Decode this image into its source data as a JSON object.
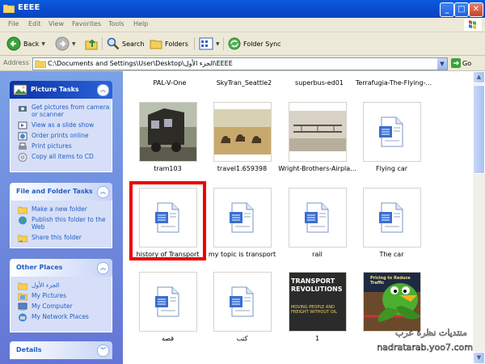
{
  "window": {
    "title": "EEEE"
  },
  "menu": {
    "items": [
      "File",
      "Edit",
      "View",
      "Favorites",
      "Tools",
      "Help"
    ]
  },
  "toolbar": {
    "back": "Back",
    "search": "Search",
    "folders": "Folders",
    "folder_sync": "Folder Sync"
  },
  "address": {
    "label": "Address",
    "path": "C:\\Documents and Settings\\User\\Desktop\\الجزء الأول\\EEEE",
    "go": "Go"
  },
  "sidebar": {
    "picture_tasks": {
      "title": "Picture Tasks",
      "items": [
        "Get pictures from camera or scanner",
        "View as a slide show",
        "Order prints online",
        "Print pictures",
        "Copy all items to CD"
      ]
    },
    "file_folder_tasks": {
      "title": "File and Folder Tasks",
      "items": [
        "Make a new folder",
        "Publish this folder to the Web",
        "Share this folder"
      ]
    },
    "other_places": {
      "title": "Other Places",
      "items": [
        "الجزء الأول",
        "My Pictures",
        "My Computer",
        "My Network Places"
      ]
    },
    "details": {
      "title": "Details"
    }
  },
  "files": {
    "top_row": [
      "PAL-V-One",
      "SkyTran_Seattle2",
      "superbus-ed01",
      "Terrafugia-The-Flying-..."
    ],
    "row1": [
      "tram103",
      "travel1.659398",
      "Wright-Brothers-Airpla...",
      "Flying car"
    ],
    "row2": [
      "history of Transport",
      "my topic is transport",
      "rail",
      "The car"
    ],
    "row3": [
      "قصه",
      "كتب",
      "1",
      ""
    ],
    "book_cover": {
      "line1": "TRANSPORT",
      "line2": "REVOLUTIONS",
      "line3": "MOVING PEOPLE AND FREIGHT WITHOUT OIL"
    },
    "book_cover2": {
      "line1": "Pricing to Reduce Traffic"
    }
  },
  "watermark": {
    "arabic": "منتديات نظرة عرب",
    "url": "nadratarab.yoo7.com"
  },
  "colors": {
    "highlight": "#e00000",
    "xp_blue": "#0a5ce0",
    "sidebar_link": "#215dc6"
  }
}
